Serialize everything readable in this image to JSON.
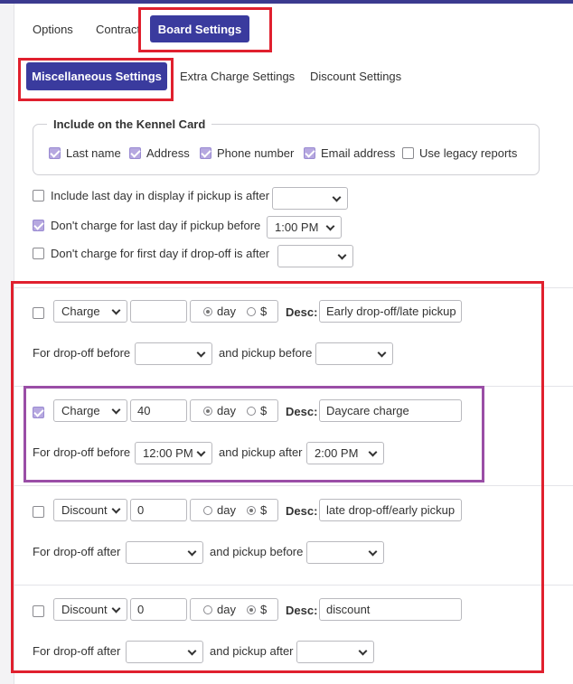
{
  "top_tabs": [
    "Options",
    "Contract",
    "Board Settings"
  ],
  "sub_tabs": [
    "Miscellaneous Settings",
    "Extra Charge Settings",
    "Discount Settings"
  ],
  "kennel_card": {
    "legend": "Include on the Kennel Card",
    "options": [
      {
        "label": "Last name",
        "checked": true
      },
      {
        "label": "Address",
        "checked": true
      },
      {
        "label": "Phone number",
        "checked": true
      },
      {
        "label": "Email address",
        "checked": true
      },
      {
        "label": "Use legacy reports",
        "checked": false
      }
    ]
  },
  "day_settings": [
    {
      "label": "Include last day in display if pickup is after",
      "checked": false,
      "value": ""
    },
    {
      "label": "Don't charge for last day if pickup before",
      "checked": true,
      "value": "1:00 PM"
    },
    {
      "label": "Don't charge for first day if drop-off is after",
      "checked": false,
      "value": ""
    }
  ],
  "rules": [
    {
      "checked": false,
      "type": "Charge",
      "amount": "",
      "unit_day": "day",
      "unit_dollar": "$",
      "unit_selected": "day",
      "desc_label": "Desc:",
      "desc": "Early drop-off/late pickup  ",
      "dropoff_label": "For drop-off before",
      "dropoff_value": "",
      "pickup_label": "and pickup before",
      "pickup_value": ""
    },
    {
      "checked": true,
      "type": "Charge",
      "amount": "40",
      "unit_day": "day",
      "unit_dollar": "$",
      "unit_selected": "day",
      "desc_label": "Desc:",
      "desc": "Daycare charge",
      "dropoff_label": "For drop-off before",
      "dropoff_value": "12:00 PM",
      "pickup_label": "and pickup after",
      "pickup_value": "2:00 PM"
    },
    {
      "checked": false,
      "type": "Discount",
      "amount": "0",
      "unit_day": "day",
      "unit_dollar": "$",
      "unit_selected": "$",
      "desc_label": "Desc:",
      "desc": "late drop-off/early pickup  ",
      "dropoff_label": "For drop-off after",
      "dropoff_value": "",
      "pickup_label": "and pickup before",
      "pickup_value": ""
    },
    {
      "checked": false,
      "type": "Discount",
      "amount": "0",
      "unit_day": "day",
      "unit_dollar": "$",
      "unit_selected": "$",
      "desc_label": "Desc:",
      "desc": "discount",
      "dropoff_label": "For drop-off after",
      "dropoff_value": "",
      "pickup_label": "and pickup after",
      "pickup_value": ""
    }
  ],
  "colors": {
    "accent": "#3a3b9e",
    "highlight_red": "#e0202e",
    "highlight_purple": "#9a4ea6",
    "checkbox_checked": "#b6a8e0"
  }
}
